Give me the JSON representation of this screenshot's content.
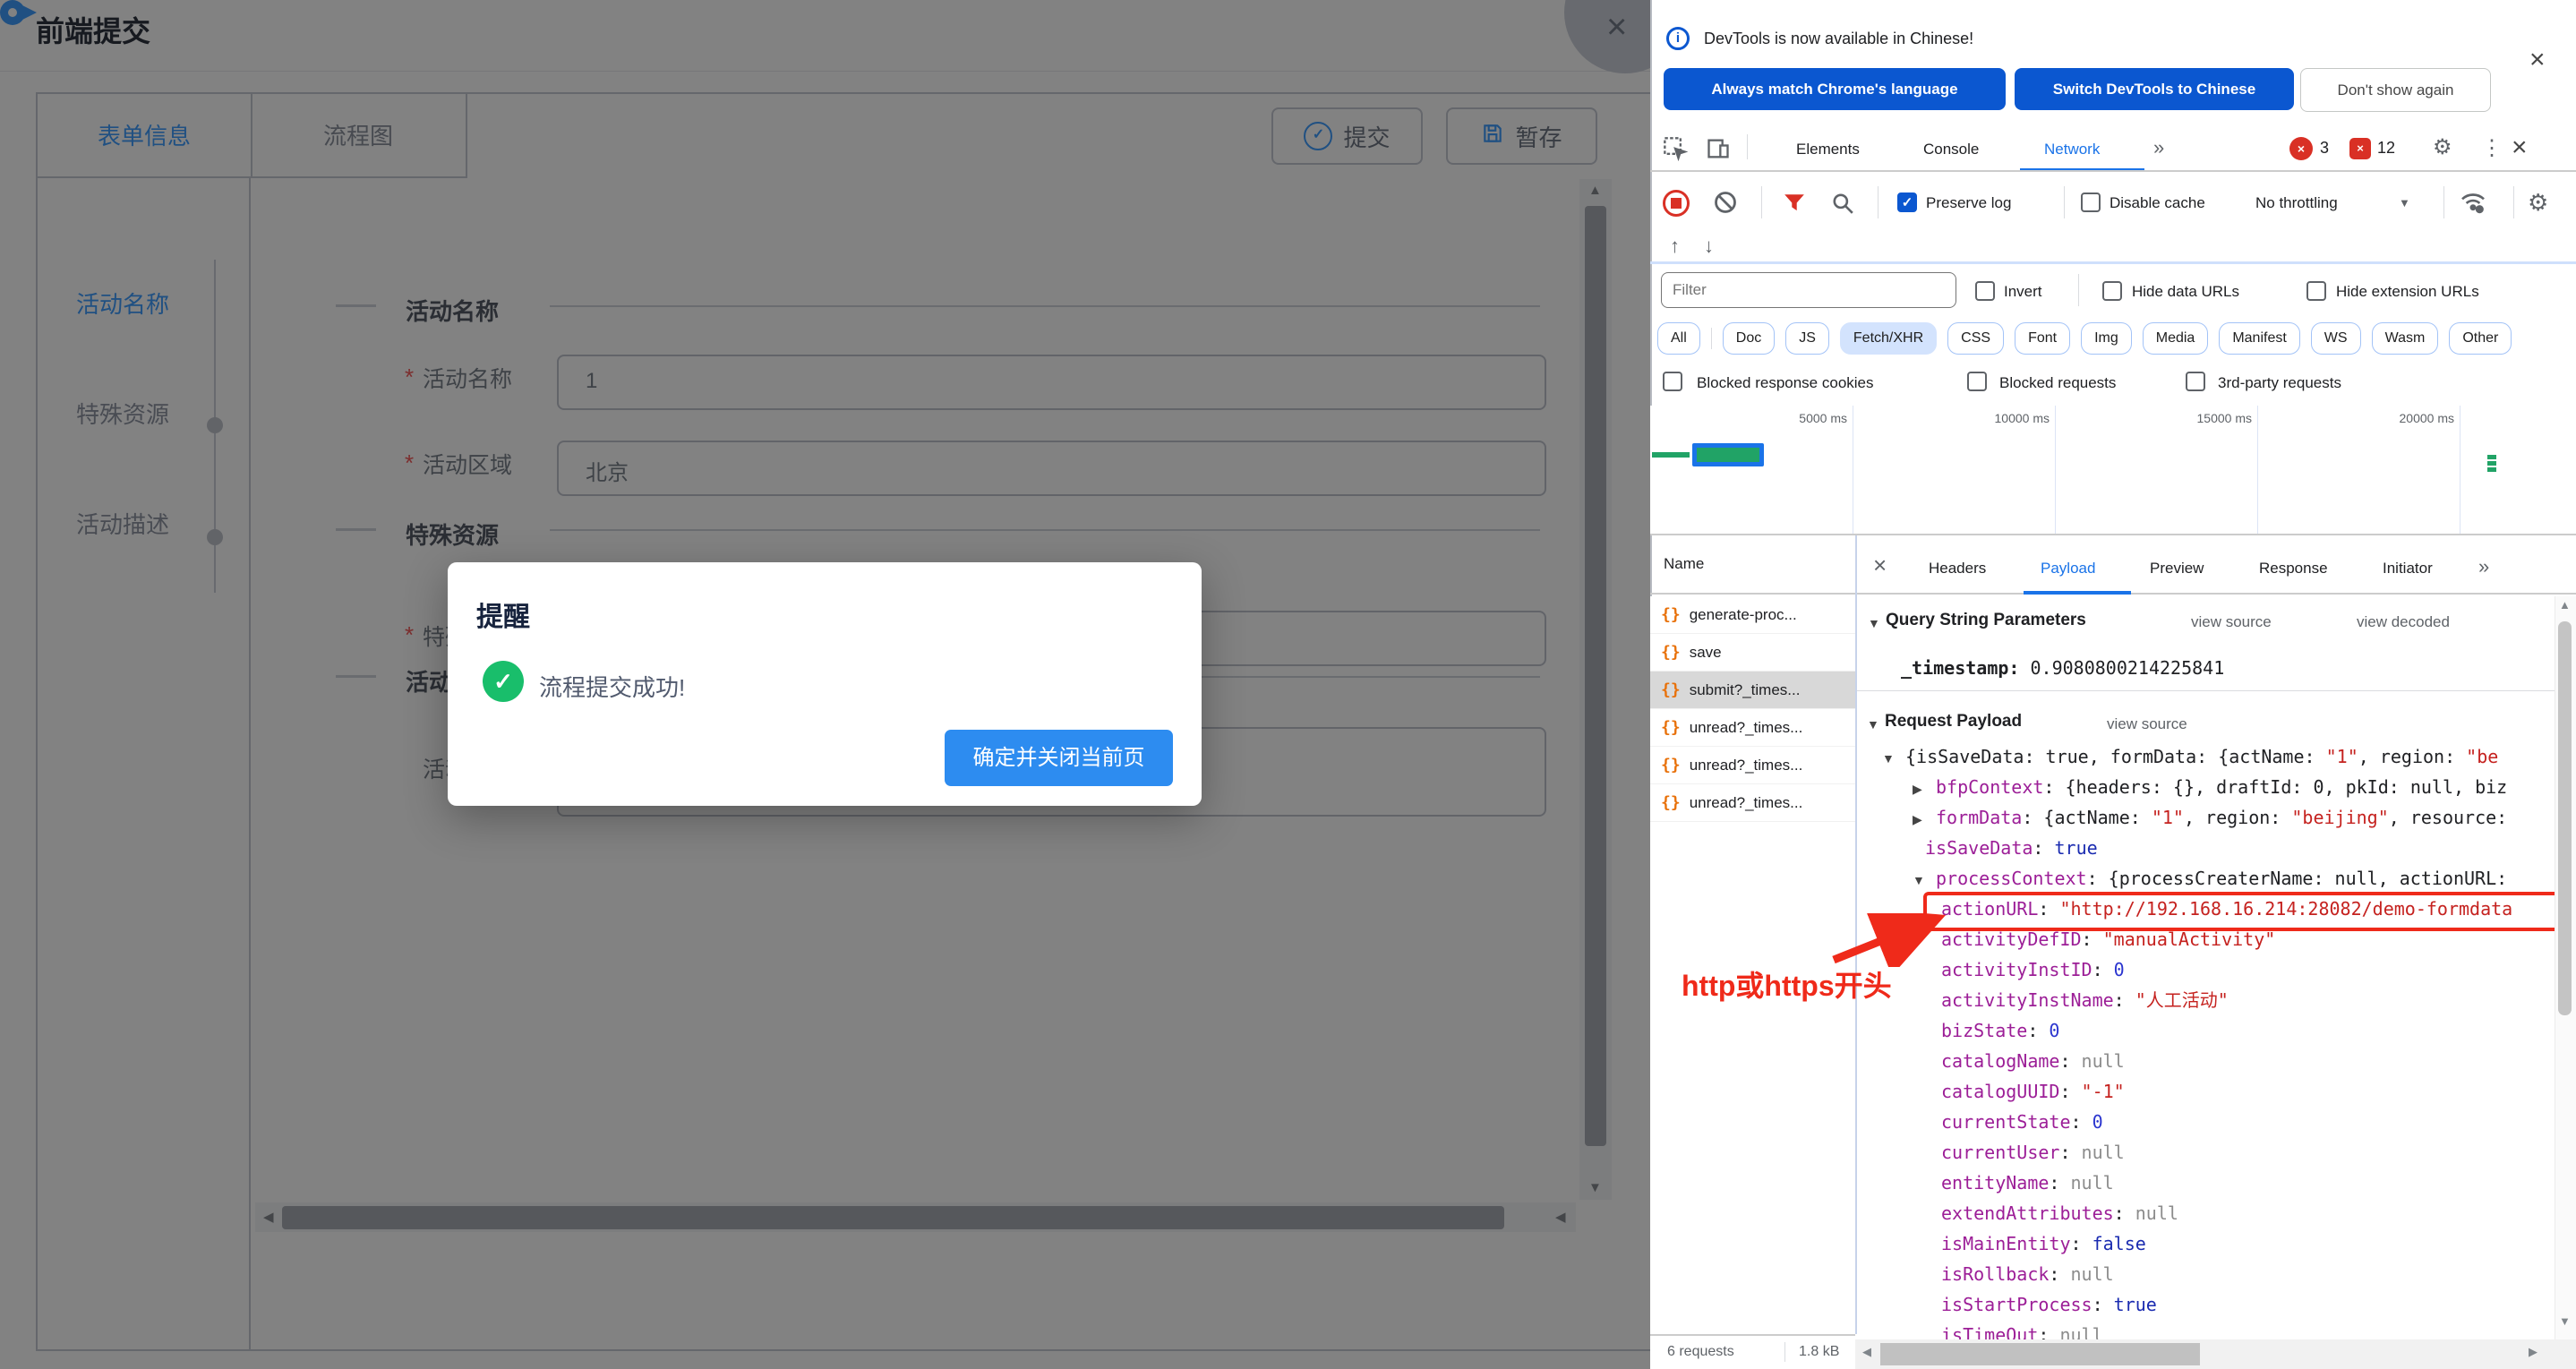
{
  "colors": {
    "chrome_blue": "#0b57d0",
    "devtools_accent": "#1a73e8",
    "error_red": "#d93025",
    "annotation_red": "#ef2a1a",
    "success_green": "#19be6b",
    "modal_button_blue": "#2d8cf0",
    "element_blue": "#409eff"
  },
  "icons": {
    "check": "✓",
    "close": "×",
    "more": "»",
    "up_arrow": "↑",
    "down_arrow": "↓",
    "gear": "⚙",
    "dots_menu": "⋮",
    "tri_down": "▼",
    "tri_right": "▶",
    "tri_up": "▲",
    "tri_left": "◀",
    "braces": "{}",
    "info": "i"
  },
  "page": {
    "title": "前端提交",
    "tabs": [
      {
        "label": "表单信息",
        "active": true
      },
      {
        "label": "流程图",
        "active": false
      }
    ],
    "toolbar": {
      "submit": "提交",
      "draft": "暂存"
    },
    "steps": [
      {
        "label": "活动名称",
        "active": true
      },
      {
        "label": "特殊资源",
        "active": false
      },
      {
        "label": "活动描述",
        "active": false
      }
    ],
    "sections": [
      "活动名称",
      "特殊资源",
      "活动描述"
    ],
    "required_mark": "*",
    "fields": [
      {
        "label": "活动名称",
        "required": true,
        "value": "1"
      },
      {
        "label": "活动区域",
        "required": true,
        "value": "北京"
      },
      {
        "label": "特殊资源",
        "required": true,
        "value": ""
      },
      {
        "label": "活动描述",
        "required": false,
        "value": ""
      }
    ]
  },
  "modal": {
    "title": "提醒",
    "message": "流程提交成功!",
    "confirm": "确定并关闭当前页"
  },
  "devtools": {
    "banner": {
      "message": "DevTools is now available in Chinese!",
      "buttons": [
        {
          "label": "Always match Chrome's language",
          "style": "primary"
        },
        {
          "label": "Switch DevTools to Chinese",
          "style": "primary"
        },
        {
          "label": "Don't show again",
          "style": "outline"
        }
      ]
    },
    "tabs": {
      "items": [
        {
          "label": "Elements",
          "active": false
        },
        {
          "label": "Console",
          "active": false
        },
        {
          "label": "Network",
          "active": true
        }
      ],
      "error_count": "3",
      "issue_count": "12"
    },
    "toolbar": {
      "preserve_log": "Preserve log",
      "disable_cache": "Disable cache",
      "throttling": "No throttling"
    },
    "filter": {
      "placeholder": "Filter",
      "invert": "Invert",
      "hide_data_urls": "Hide data URLs",
      "hide_extension_urls": "Hide extension URLs"
    },
    "chips": [
      {
        "label": "All",
        "active": false
      },
      {
        "label": "Doc",
        "active": false
      },
      {
        "label": "JS",
        "active": false
      },
      {
        "label": "Fetch/XHR",
        "active": true
      },
      {
        "label": "CSS",
        "active": false
      },
      {
        "label": "Font",
        "active": false
      },
      {
        "label": "Img",
        "active": false
      },
      {
        "label": "Media",
        "active": false
      },
      {
        "label": "Manifest",
        "active": false
      },
      {
        "label": "WS",
        "active": false
      },
      {
        "label": "Wasm",
        "active": false
      },
      {
        "label": "Other",
        "active": false
      }
    ],
    "blocked": [
      "Blocked response cookies",
      "Blocked requests",
      "3rd-party requests"
    ],
    "timeline": {
      "ticks": [
        "5000 ms",
        "10000 ms",
        "15000 ms",
        "20000 ms"
      ]
    },
    "requests": {
      "header": "Name",
      "items": [
        {
          "name": "generate-proc...",
          "selected": false
        },
        {
          "name": "save",
          "selected": false
        },
        {
          "name": "submit?_times...",
          "selected": true
        },
        {
          "name": "unread?_times...",
          "selected": false
        },
        {
          "name": "unread?_times...",
          "selected": false
        },
        {
          "name": "unread?_times...",
          "selected": false
        }
      ]
    },
    "detail_tabs": [
      {
        "label": "Headers",
        "active": false
      },
      {
        "label": "Payload",
        "active": true
      },
      {
        "label": "Preview",
        "active": false
      },
      {
        "label": "Response",
        "active": false
      },
      {
        "label": "Initiator",
        "active": false
      }
    ],
    "payload": {
      "query_title": "Query String Parameters",
      "view_source": "view source",
      "view_decoded": "view decoded",
      "timestamp_key": "_timestamp:",
      "timestamp_value": "0.9080800214225841",
      "request_payload_title": "Request Payload",
      "tree": [
        {
          "indent": 0,
          "arrow": "▼",
          "segs": [
            [
              "{isSaveData: true, formData: {actName: ",
              "p"
            ],
            [
              "\"1\"",
              "s"
            ],
            [
              ", region: ",
              "p"
            ],
            [
              "\"be",
              "s"
            ]
          ]
        },
        {
          "indent": 1,
          "arrow": "▶",
          "segs": [
            [
              "bfpContext",
              "k"
            ],
            [
              ": {headers: {}, draftId: 0, pkId: null, biz",
              "p"
            ]
          ]
        },
        {
          "indent": 1,
          "arrow": "▶",
          "segs": [
            [
              "formData",
              "k"
            ],
            [
              ": {actName: ",
              "p"
            ],
            [
              "\"1\"",
              "s"
            ],
            [
              ", region: ",
              "p"
            ],
            [
              "\"beijing\"",
              "s"
            ],
            [
              ", resource:",
              "p"
            ]
          ]
        },
        {
          "indent": 1,
          "segs": [
            [
              "isSaveData",
              "k"
            ],
            [
              ": ",
              "p"
            ],
            [
              "true",
              "b"
            ]
          ]
        },
        {
          "indent": 1,
          "arrow": "▼",
          "segs": [
            [
              "processContext",
              "k"
            ],
            [
              ": {processCreaterName: null, actionURL:",
              "p"
            ]
          ]
        },
        {
          "indent": 2,
          "boxed": true,
          "segs": [
            [
              "actionURL",
              "k"
            ],
            [
              ": ",
              "p"
            ],
            [
              "\"http://192.168.16.214:28082/demo-formdata",
              "s"
            ]
          ]
        },
        {
          "indent": 2,
          "segs": [
            [
              "activityDefID",
              "k"
            ],
            [
              ": ",
              "p"
            ],
            [
              "\"manualActivity\"",
              "s"
            ]
          ]
        },
        {
          "indent": 2,
          "segs": [
            [
              "activityInstID",
              "k"
            ],
            [
              ": ",
              "p"
            ],
            [
              "0",
              "n"
            ]
          ]
        },
        {
          "indent": 2,
          "segs": [
            [
              "activityInstName",
              "k"
            ],
            [
              ": ",
              "p"
            ],
            [
              "\"人工活动\"",
              "s"
            ]
          ]
        },
        {
          "indent": 2,
          "segs": [
            [
              "bizState",
              "k"
            ],
            [
              ": ",
              "p"
            ],
            [
              "0",
              "n"
            ]
          ]
        },
        {
          "indent": 2,
          "segs": [
            [
              "catalogName",
              "k"
            ],
            [
              ": ",
              "p"
            ],
            [
              "null",
              "u"
            ]
          ]
        },
        {
          "indent": 2,
          "segs": [
            [
              "catalogUUID",
              "k"
            ],
            [
              ": ",
              "p"
            ],
            [
              "\"-1\"",
              "s"
            ]
          ]
        },
        {
          "indent": 2,
          "segs": [
            [
              "currentState",
              "k"
            ],
            [
              ": ",
              "p"
            ],
            [
              "0",
              "n"
            ]
          ]
        },
        {
          "indent": 2,
          "segs": [
            [
              "currentUser",
              "k"
            ],
            [
              ": ",
              "p"
            ],
            [
              "null",
              "u"
            ]
          ]
        },
        {
          "indent": 2,
          "segs": [
            [
              "entityName",
              "k"
            ],
            [
              ": ",
              "p"
            ],
            [
              "null",
              "u"
            ]
          ]
        },
        {
          "indent": 2,
          "segs": [
            [
              "extendAttributes",
              "k"
            ],
            [
              ": ",
              "p"
            ],
            [
              "null",
              "u"
            ]
          ]
        },
        {
          "indent": 2,
          "segs": [
            [
              "isMainEntity",
              "k"
            ],
            [
              ": ",
              "p"
            ],
            [
              "false",
              "b"
            ]
          ]
        },
        {
          "indent": 2,
          "segs": [
            [
              "isRollback",
              "k"
            ],
            [
              ": ",
              "p"
            ],
            [
              "null",
              "u"
            ]
          ]
        },
        {
          "indent": 2,
          "segs": [
            [
              "isStartProcess",
              "k"
            ],
            [
              ": ",
              "p"
            ],
            [
              "true",
              "b"
            ]
          ]
        },
        {
          "indent": 2,
          "segs": [
            [
              "isTimeOut",
              "k"
            ],
            [
              ": ",
              "p"
            ],
            [
              "null",
              "u"
            ]
          ]
        }
      ]
    },
    "annotation": "http或https开头",
    "status": {
      "requests_count": "6 requests",
      "transferred": "1.8 kB"
    }
  }
}
